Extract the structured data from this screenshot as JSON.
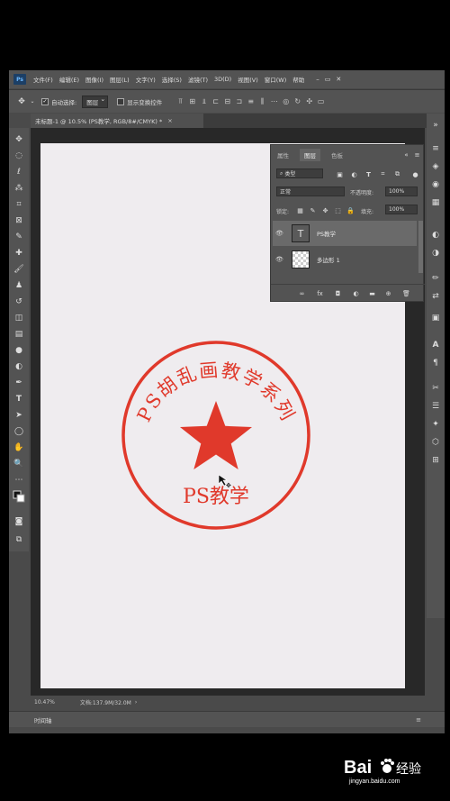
{
  "menu": {
    "items": [
      "文件(F)",
      "编辑(E)",
      "图像(I)",
      "图层(L)",
      "文字(Y)",
      "选择(S)",
      "滤镜(T)",
      "3D(D)",
      "视图(V)",
      "窗口(W)",
      "帮助"
    ],
    "logo": "Ps"
  },
  "options": {
    "auto_select_label": "自动选择:",
    "auto_select_value": "图层",
    "show_transform_label": "显示变换控件"
  },
  "document": {
    "tab_title": "未标题-1 @ 10.5% (PS教学, RGB/8#/CMYK) *",
    "zoom": "10.47%",
    "doc_info": "文档:137.9M/32.0M"
  },
  "layers_panel": {
    "tabs": [
      "属性",
      "图层",
      "色板"
    ],
    "kind_filter": "类型",
    "blend_mode": "正常",
    "opacity_label": "不透明度:",
    "opacity_value": "100%",
    "lock_label": "锁定:",
    "fill_label": "填充:",
    "fill_value": "100%",
    "layers": [
      {
        "name": "PS教学",
        "type": "text"
      },
      {
        "name": "多边形 1",
        "type": "shape"
      }
    ]
  },
  "stamp": {
    "arc_text": "PS胡乱画教学系列",
    "center_text": "PS教学",
    "color": "#e0392b"
  },
  "timeline_label": "时间轴",
  "watermark": {
    "brand": "Bai",
    "brand2": "du",
    "suffix": "经验",
    "url": "jingyan.baidu.com"
  }
}
